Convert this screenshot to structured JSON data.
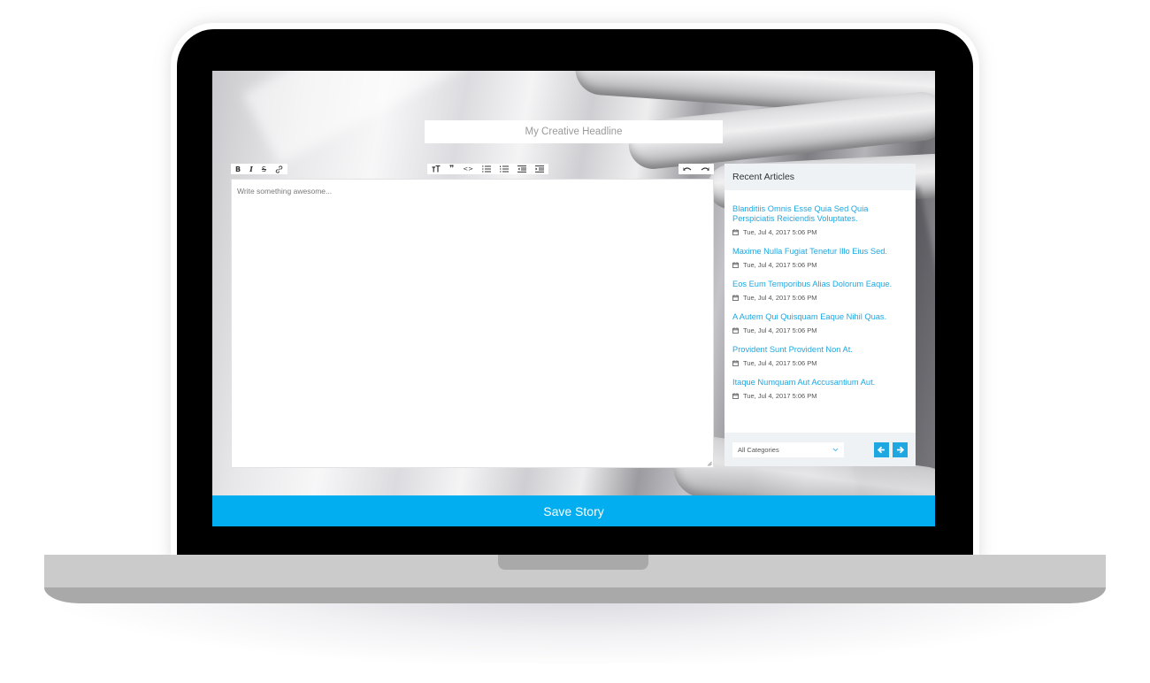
{
  "editor": {
    "headline_placeholder": "My Creative Headline",
    "body_placeholder": "Write something awesome...",
    "toolbar_left": [
      {
        "name": "bold-button",
        "icon": "bold-icon",
        "glyph": "B"
      },
      {
        "name": "italic-button",
        "icon": "italic-icon",
        "glyph": "I"
      },
      {
        "name": "strikethrough-button",
        "icon": "strikethrough-icon",
        "glyph": "S"
      },
      {
        "name": "link-button",
        "icon": "link-icon",
        "glyph": ""
      }
    ],
    "toolbar_center": [
      {
        "name": "heading-button",
        "icon": "text-size-icon"
      },
      {
        "name": "quote-button",
        "icon": "quote-icon"
      },
      {
        "name": "code-button",
        "icon": "code-icon"
      },
      {
        "name": "bullet-list-button",
        "icon": "bullet-list-icon"
      },
      {
        "name": "numbered-list-button",
        "icon": "numbered-list-icon"
      },
      {
        "name": "outdent-button",
        "icon": "outdent-icon"
      },
      {
        "name": "indent-button",
        "icon": "indent-icon"
      }
    ],
    "toolbar_right": [
      {
        "name": "undo-button",
        "icon": "undo-icon"
      },
      {
        "name": "redo-button",
        "icon": "redo-icon"
      }
    ]
  },
  "sidebar": {
    "title": "Recent Articles",
    "articles": [
      {
        "title": "Blanditiis Omnis Esse Quia Sed Quia Perspiciatis Reiciendis Voluptates.",
        "date": "Tue, Jul 4, 2017 5:06 PM"
      },
      {
        "title": "Maxime Nulla Fugiat Tenetur Illo Eius Sed.",
        "date": "Tue, Jul 4, 2017 5:06 PM"
      },
      {
        "title": "Eos Eum Temporibus Alias Dolorum Eaque.",
        "date": "Tue, Jul 4, 2017 5:06 PM"
      },
      {
        "title": "A Autem Qui Quisquam Eaque Nihil Quas.",
        "date": "Tue, Jul 4, 2017 5:06 PM"
      },
      {
        "title": "Provident Sunt Provident Non At.",
        "date": "Tue, Jul 4, 2017 5:06 PM"
      },
      {
        "title": "Itaque Numquam Aut Accusantium Aut.",
        "date": "Tue, Jul 4, 2017 5:06 PM"
      }
    ],
    "category_select": {
      "selected": "All Categories"
    },
    "prev_icon": "arrow-left-icon",
    "next_icon": "arrow-right-icon"
  },
  "actions": {
    "save_label": "Save Story"
  },
  "colors": {
    "accent": "#02aeef",
    "link": "#1ea7e0",
    "panel_header": "#eef2f5"
  }
}
